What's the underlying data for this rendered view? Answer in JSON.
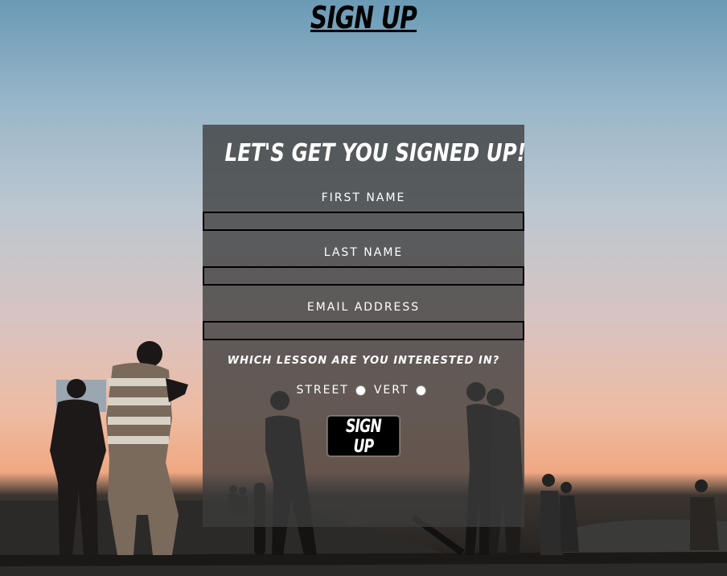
{
  "page": {
    "title": "SIGN UP"
  },
  "form": {
    "heading": "LET'S GET YOU SIGNED UP!",
    "fields": [
      {
        "label": "FIRST NAME",
        "value": "",
        "placeholder": ""
      },
      {
        "label": "LAST NAME",
        "value": "",
        "placeholder": ""
      },
      {
        "label": "EMAIL ADDRESS",
        "value": "",
        "placeholder": ""
      }
    ],
    "lesson_question": "WHICH LESSON ARE YOU INTERESTED IN?",
    "options": [
      {
        "label": "STREET",
        "checked": false
      },
      {
        "label": "VERT",
        "checked": false
      }
    ],
    "submit_label": "SIGN UP"
  },
  "colors": {
    "panel": "#3c3c3c",
    "text": "#ffffff",
    "button": "#000000"
  }
}
